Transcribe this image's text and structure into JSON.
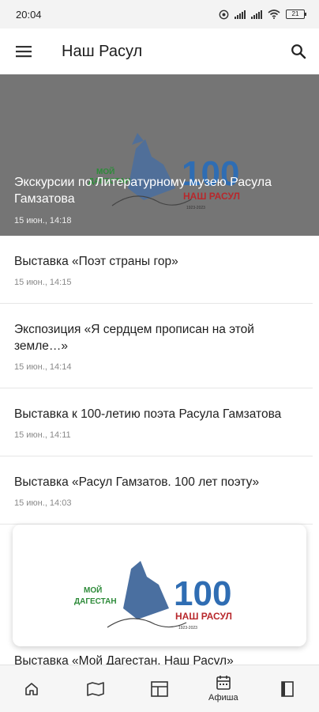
{
  "status_bar": {
    "time": "20:04",
    "battery": "21"
  },
  "app_bar": {
    "title": "Наш Расул",
    "menu_icon": "hamburger-menu-icon",
    "search_icon": "search-icon"
  },
  "hero": {
    "title": "Экскурсии по Литературному музею Расула Гамзатова",
    "date": "15 июн., 14:18",
    "logo": {
      "left_text": [
        "МОЙ",
        "ДАГЕСТАН"
      ],
      "number": "100",
      "subtitle": "НАШ РАСУЛ",
      "years": "1923-2023"
    }
  },
  "news": [
    {
      "title": "Выставка «Поэт страны гор»",
      "date": "15 июн., 14:15"
    },
    {
      "title": "Экспозиция «Я сердцем прописан на этой земле…»",
      "date": "15 июн., 14:14"
    },
    {
      "title": "Выставка к 100-летию поэта Расула Гамзатова",
      "date": "15 июн., 14:11"
    },
    {
      "title": "Выставка «Расул Гамзатов. 100 лет поэту»",
      "date": "15 июн., 14:03"
    }
  ],
  "card": {
    "logo": {
      "left_text": [
        "МОЙ",
        "ДАГЕСТАН"
      ],
      "number": "100",
      "subtitle": "НАШ РАСУЛ",
      "years": "1923-2023"
    },
    "caption": "Выставка «Мой Дагестан. Наш Расул»"
  },
  "bottom_nav": [
    {
      "icon": "home-icon",
      "label": ""
    },
    {
      "icon": "map-icon",
      "label": ""
    },
    {
      "icon": "layout-icon",
      "label": ""
    },
    {
      "icon": "calendar-icon",
      "label": "Афиша"
    },
    {
      "icon": "book-icon",
      "label": ""
    }
  ],
  "colors": {
    "hero_overlay": "#757575",
    "logo_green": "#2e8b3a",
    "logo_blue": "#1f5fa8",
    "logo_red": "#c0262b"
  }
}
